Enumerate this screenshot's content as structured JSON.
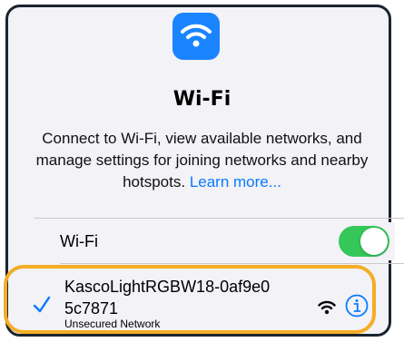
{
  "header": {
    "title": "Wi-Fi",
    "description": "Connect to Wi-Fi, view available networks, and manage settings for joining networks and nearby hotspots.",
    "learn_more": "Learn more..."
  },
  "wifi_row": {
    "label": "Wi-Fi",
    "enabled": true
  },
  "network": {
    "name_line1": "KascoLightRGBW18-0af9e0",
    "name_line2": "5c7871",
    "subtitle": "Unsecured Network",
    "connected": true
  },
  "colors": {
    "accent": "#0a7aff",
    "toggle_on": "#34c759",
    "icon_bg": "#1a84ff",
    "highlight": "#f4ad26",
    "frame": "#1b2430"
  },
  "icons": {
    "app": "wifi-icon",
    "check": "checkmark-icon",
    "signal": "wifi-signal-icon",
    "info": "info-icon"
  }
}
